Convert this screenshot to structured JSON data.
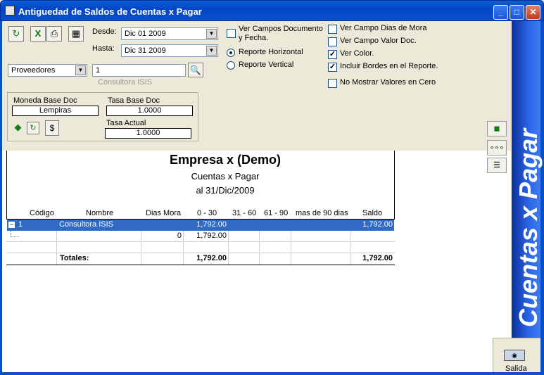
{
  "window": {
    "title": "Antiguedad de Saldos de Cuentas x Pagar"
  },
  "filters": {
    "desde_label": "Desde:",
    "desde_value": "Dic  01  2009",
    "hasta_label": "Hasta:",
    "hasta_value": "Dic  31  2009",
    "entity_type": "Proveedores",
    "entity_code": "1",
    "entity_name": "Consultora ISIS"
  },
  "options": {
    "ver_campos_doc": "Ver Campos Documento y Fecha.",
    "reporte_horizontal": "Reporte Horizontal",
    "reporte_vertical": "Reporte Vertical",
    "ver_dias_mora": "Ver Campo Dias de Mora",
    "ver_valor_doc": "Ver Campo Valor Doc.",
    "ver_color": "Ver Color.",
    "incluir_bordes": "Incluir Bordes en el Reporte.",
    "no_mostrar_cero": "No Mostrar Valores en Cero"
  },
  "moneda": {
    "base_label": "Moneda Base Doc",
    "base_value": "Lempiras",
    "tasa_base_label": "Tasa Base Doc",
    "tasa_base_value": "1.0000",
    "tasa_actual_label": "Tasa Actual",
    "tasa_actual_value": "1.0000"
  },
  "report": {
    "company": "Empresa  x  (Demo)",
    "subtitle": "Cuentas x Pagar",
    "date": "al 31/Dic/2009",
    "columns": [
      "Código",
      "Nombre",
      "Dias Mora",
      "0 - 30",
      "31 - 60",
      "61 - 90",
      "mas de 90 dias",
      "Saldo"
    ],
    "row1": {
      "codigo": "1",
      "nombre": "Consultora ISIS",
      "c030": "1,792.00",
      "saldo": "1,792.00"
    },
    "row2": {
      "dias": "0",
      "c030": "1,792.00"
    },
    "totals": {
      "label": "Totales:",
      "c030": "1,792.00",
      "saldo": "1,792.00"
    }
  },
  "side": {
    "title": "Cuentas x Pagar",
    "exit_label": "Salida"
  }
}
